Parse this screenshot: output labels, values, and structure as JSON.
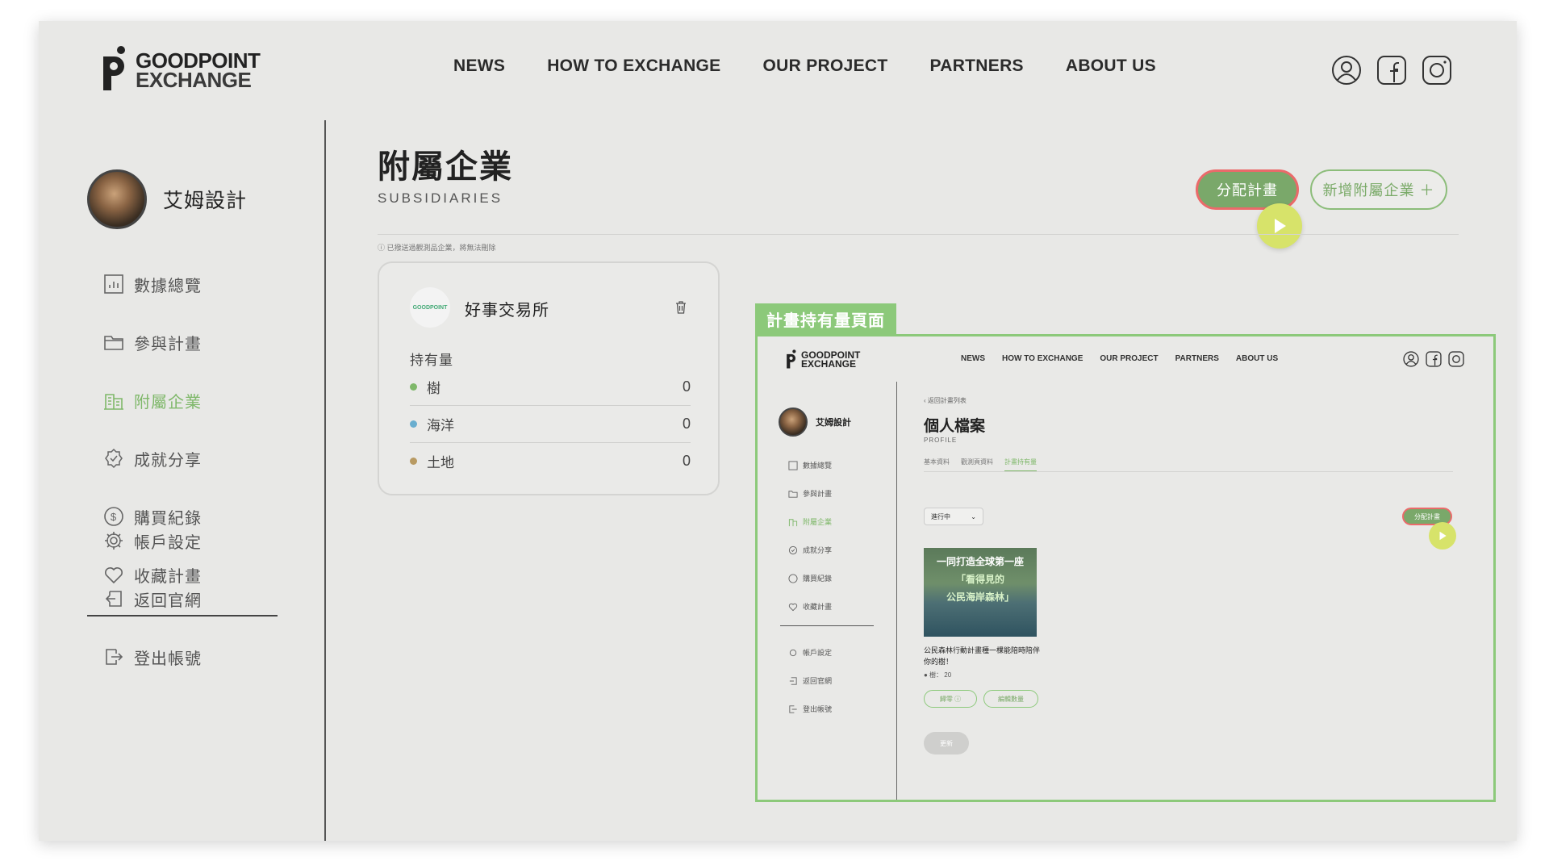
{
  "brand": {
    "line1": "GOODPOINT",
    "line2": "EXCHANGE"
  },
  "nav": [
    "NEWS",
    "HOW TO EXCHANGE",
    "OUR PROJECT",
    "PARTNERS",
    "ABOUT US"
  ],
  "social": [
    "user-icon",
    "facebook-icon",
    "instagram-icon"
  ],
  "sidebar": {
    "user_name": "艾姆設計",
    "items": [
      {
        "label": "數據總覽",
        "icon": "chart-icon"
      },
      {
        "label": "參與計畫",
        "icon": "folder-icon"
      },
      {
        "label": "附屬企業",
        "icon": "building-icon",
        "active": true
      },
      {
        "label": "成就分享",
        "icon": "badge-icon"
      },
      {
        "label": "購買紀錄",
        "icon": "dollar-icon"
      },
      {
        "label": "收藏計畫",
        "icon": "heart-icon"
      }
    ],
    "bottom_items": [
      {
        "label": "帳戶設定",
        "icon": "gear-icon"
      },
      {
        "label": "返回官網",
        "icon": "return-icon"
      },
      {
        "label": "登出帳號",
        "icon": "logout-icon"
      }
    ]
  },
  "main": {
    "title": "附屬企業",
    "subtitle": "SUBSIDIARIES",
    "assign_button": "分配計畫",
    "add_button": "新增附屬企業 ＋",
    "note": "ⓘ 已撥送過觀測品企業，將無法刪除"
  },
  "card": {
    "logo_text": "GOODPOINT",
    "name": "好事交易所",
    "holdings_label": "持有量",
    "holdings": [
      {
        "name": "樹",
        "value": "0",
        "color": "#7fb86a"
      },
      {
        "name": "海洋",
        "value": "0",
        "color": "#6aaecf"
      },
      {
        "name": "土地",
        "value": "0",
        "color": "#b89a62"
      }
    ]
  },
  "preview": {
    "tag": "計畫持有量頁面",
    "brand": {
      "line1": "GOODPOINT",
      "line2": "EXCHANGE"
    },
    "nav": [
      "NEWS",
      "HOW TO EXCHANGE",
      "OUR PROJECT",
      "PARTNERS",
      "ABOUT US"
    ],
    "user_name": "艾姆設計",
    "items": [
      "數據總覽",
      "參與計畫",
      "附屬企業",
      "成就分享",
      "購買紀錄",
      "收藏計畫"
    ],
    "bottom_items": [
      "帳戶設定",
      "返回官網",
      "登出帳號"
    ],
    "back_link": "返回計畫列表",
    "title": "個人檔案",
    "subtitle": "PROFILE",
    "tabs": [
      "基本資料",
      "觀測頁資料",
      "計畫持有量"
    ],
    "select_value": "進行中",
    "assign_button": "分配計畫",
    "project_image_lines": [
      "一同打造全球第一座",
      "「看得見的",
      "公民海岸森林」"
    ],
    "project_caption": "公民森林行動計畫種一棵能陪時陪伴你的樹！",
    "project_stat": "● 樹： 20",
    "pill_1": "歸零 ⓘ",
    "pill_2": "編輯數量",
    "update_button": "更新"
  },
  "colors": {
    "accent_green": "#7fb86a",
    "highlight_red": "#ea6a6a",
    "cursor_yellow": "#d7e36a"
  }
}
